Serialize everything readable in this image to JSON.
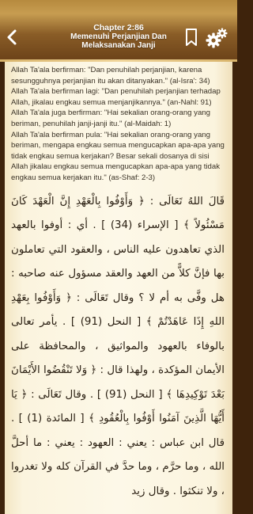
{
  "header": {
    "chapter": "Chapter 2:86",
    "title_line1": "Memenuhi Perjanjian Dan",
    "title_line2": "Melaksanakan Janji",
    "back_icon": "chevron-left-icon",
    "bookmark_icon": "bookmark-icon",
    "settings_icon": "gears-icon"
  },
  "colors": {
    "header_gold": "#b68a3e",
    "header_brown": "#6a4118",
    "page_background": "#fdf8e8",
    "frame_brown": "#3e230c",
    "text": "#3a3226"
  },
  "body": {
    "paragraphs": [
      "Allah Ta'ala berfirman: \"Dan penuhilah perjanjian, karena sesungguhnya perjanjian itu akan ditanyakan.\" (al-Isra': 34)",
      "Allah Ta'ala berfirman lagi: \"Dan penuhilah perjanjian terhadap Allah, jikalau engkau semua menjanjikannya.\" (an-Nahl: 91)",
      "Allah Ta'ala juga berfirman: \"Hai sekalian orang-orang yang beriman, penuhilah janji-janji itu.\" (al-Maidah: 1)",
      "Allah Ta'ala berfirman pula: \"Hai sekalian orang-orang yang beriman, mengapa engkau semua mengucapkan apa-apa yang tidak engkau semua kerjakan? Besar sekali dosanya di sisi Allah jikalau engkau semua mengucapkan apa-apa yang tidak engkau semua kerjakan itu.\" (as-Shaf: 2-3)"
    ],
    "arabic": "قَالَ اللهُ تَعَالَى : ﴿ وَأَوْفُوا بِالْعَهْدِ إِنَّ الْعَهْدَ كَانَ مَسْئُولاً ﴾ [ الإسراء (34) ] . أي : أوفوا بالعهد الذي تعاهدون عليه الناس ، والعقود التي تعاملون بها فإنَّ كلاًّ من العهد والعقد مسؤول عنه صاحبه : هل وفَّى به أم لا ؟ وقال تَعَالَى : ﴿ وَأَوْفُوا بِعَهْدِ اللهِ إِذَا عَاهَدْتُمْ ﴾ [ النحل (91) ] . يأمر تعالى بالوفاء بالعهود والمواثيق ، والمحافظة على الأيمان المؤكدة ، ولهذا قال : ﴿ وَلا تَنْقُضُوا الأَيْمَانَ بَعْدَ تَوْكِيدِهَا ﴾ [ النحل (91) ] . وقال تَعَالَى : ﴿ يَا أَيُّهَا الَّذِينَ آمَنُوا أَوْفُوا بِالْعُقُودِ ﴾ [ المائدة (1) ] . قال ابن عباس : يعني : العهود : يعني : ما أحلَّ الله ، وما حرَّم ، وما حدَّ في القرآن كله ولا تغدروا ، ولا تنكثوا . وقال زيد"
  }
}
